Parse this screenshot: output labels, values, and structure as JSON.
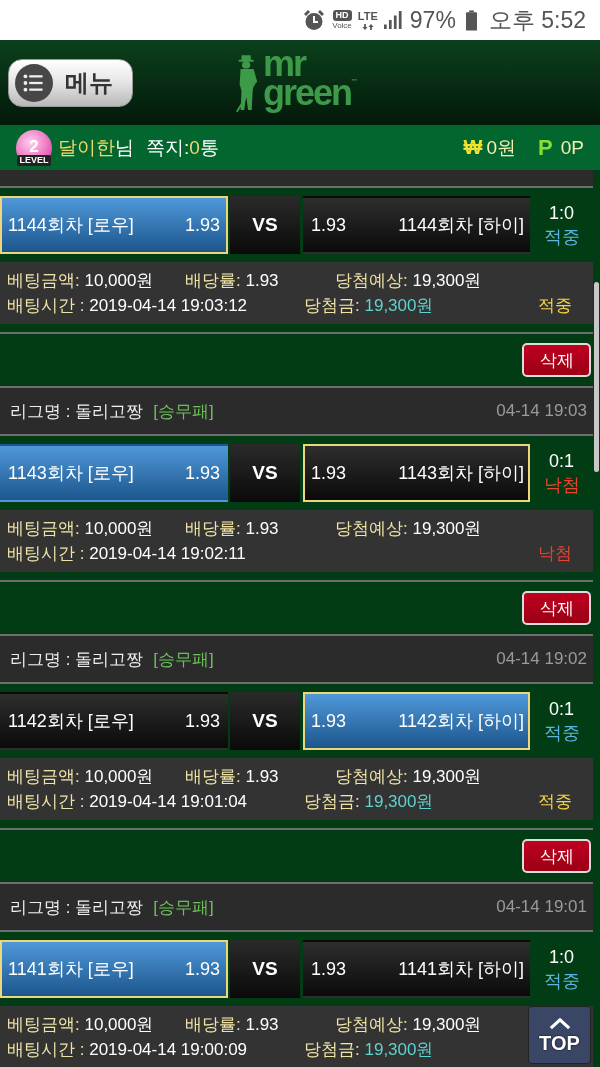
{
  "status_bar": {
    "hd": "HD",
    "voice": "Voice",
    "lte": "LTE",
    "battery": "97%",
    "time": "오후 5:52"
  },
  "header": {
    "menu_button": "메뉴",
    "logo": {
      "line1": "mr",
      "line2": "green",
      "mark": "™"
    }
  },
  "user_bar": {
    "level_badge": {
      "number": "2",
      "caption": "LEVEL"
    },
    "nickname": "달이한",
    "honorific": "님",
    "messages": {
      "label": "쪽지:",
      "count": "0",
      "unit": "통"
    },
    "cash": {
      "symbol": "₩",
      "value": "0원"
    },
    "points": {
      "symbol": "P",
      "value": "0P"
    }
  },
  "bets": [
    {
      "options": [
        {
          "name": "1144회차 [로우]",
          "odds": "1.93",
          "winning": true,
          "selected": true
        },
        {
          "name": "1144회차 [하이]",
          "odds": "1.93",
          "winning": false,
          "selected": false
        }
      ],
      "vs": "VS",
      "score": "1:0",
      "hit": true,
      "result": "적중",
      "info": {
        "stake": {
          "label": "베팅금액:",
          "value": "10,000원"
        },
        "rate": {
          "label": "배당률:",
          "value": "1.93"
        },
        "expected": {
          "label": "당첨예상:",
          "value": "19,300원"
        },
        "time": {
          "label": "배팅시간 :",
          "value": "2019-04-14 19:03:12"
        },
        "payout": {
          "label": "당첨금:",
          "value": "19,300원"
        },
        "status": "적중"
      }
    },
    {
      "delete_button": "삭제",
      "league": {
        "name": "리그명 : 돌리고짱",
        "type": "[승무패]",
        "time": "04-14 19:03"
      },
      "options": [
        {
          "name": "1143회차 [로우]",
          "odds": "1.93",
          "winning": true,
          "selected": false
        },
        {
          "name": "1143회차 [하이]",
          "odds": "1.93",
          "winning": false,
          "selected": true
        }
      ],
      "vs": "VS",
      "score": "0:1",
      "hit": false,
      "result": "낙첨",
      "info": {
        "stake": {
          "label": "베팅금액:",
          "value": "10,000원"
        },
        "rate": {
          "label": "배당률:",
          "value": "1.93"
        },
        "expected": {
          "label": "당첨예상:",
          "value": "19,300원"
        },
        "time": {
          "label": "배팅시간 :",
          "value": "2019-04-14 19:02:11"
        },
        "status": "낙첨"
      }
    },
    {
      "delete_button": "삭제",
      "league": {
        "name": "리그명 : 돌리고짱",
        "type": "[승무패]",
        "time": "04-14 19:02"
      },
      "options": [
        {
          "name": "1142회차 [로우]",
          "odds": "1.93",
          "winning": false,
          "selected": false
        },
        {
          "name": "1142회차 [하이]",
          "odds": "1.93",
          "winning": true,
          "selected": true
        }
      ],
      "vs": "VS",
      "score": "0:1",
      "hit": true,
      "result": "적중",
      "info": {
        "stake": {
          "label": "베팅금액:",
          "value": "10,000원"
        },
        "rate": {
          "label": "배당률:",
          "value": "1.93"
        },
        "expected": {
          "label": "당첨예상:",
          "value": "19,300원"
        },
        "time": {
          "label": "배팅시간 :",
          "value": "2019-04-14 19:01:04"
        },
        "payout": {
          "label": "당첨금:",
          "value": "19,300원"
        },
        "status": "적중"
      }
    },
    {
      "delete_button": "삭제",
      "league": {
        "name": "리그명 : 돌리고짱",
        "type": "[승무패]",
        "time": "04-14 19:01"
      },
      "options": [
        {
          "name": "1141회차 [로우]",
          "odds": "1.93",
          "winning": true,
          "selected": true
        },
        {
          "name": "1141회차 [하이]",
          "odds": "1.93",
          "winning": false,
          "selected": false
        }
      ],
      "vs": "VS",
      "score": "1:0",
      "hit": true,
      "result": "적중",
      "info": {
        "stake": {
          "label": "베팅금액:",
          "value": "10,000원"
        },
        "rate": {
          "label": "배당률:",
          "value": "1.93"
        },
        "expected": {
          "label": "당첨예상:",
          "value": "19,300원"
        },
        "time": {
          "label": "배팅시간 :",
          "value": "2019-04-14 19:00:09"
        },
        "payout": {
          "label": "당첨금:",
          "value": "19,300원"
        }
      }
    }
  ],
  "top_button": "TOP"
}
